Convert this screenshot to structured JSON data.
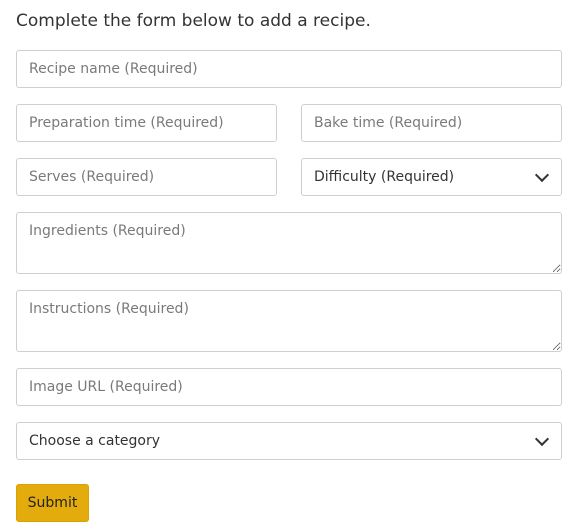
{
  "intro_text": "Complete the form below to add a recipe.",
  "form": {
    "recipe_name": {
      "placeholder": "Recipe name (Required)",
      "value": ""
    },
    "preparation_time": {
      "placeholder": "Preparation time (Required)",
      "value": ""
    },
    "bake_time": {
      "placeholder": "Bake time (Required)",
      "value": ""
    },
    "serves": {
      "placeholder": "Serves (Required)",
      "value": ""
    },
    "difficulty": {
      "selected": "Difficulty (Required)"
    },
    "ingredients": {
      "placeholder": "Ingredients (Required)",
      "value": ""
    },
    "instructions": {
      "placeholder": "Instructions (Required)",
      "value": ""
    },
    "image_url": {
      "placeholder": "Image URL (Required)",
      "value": ""
    },
    "category": {
      "selected": "Choose a category"
    },
    "submit_label": "Submit"
  },
  "icons": {
    "select_indicator": "chevron-down-icon"
  },
  "colors": {
    "submit_background": "#e4ab0c",
    "field_border": "#cfcfcf",
    "placeholder_text": "#7a7a7a"
  }
}
